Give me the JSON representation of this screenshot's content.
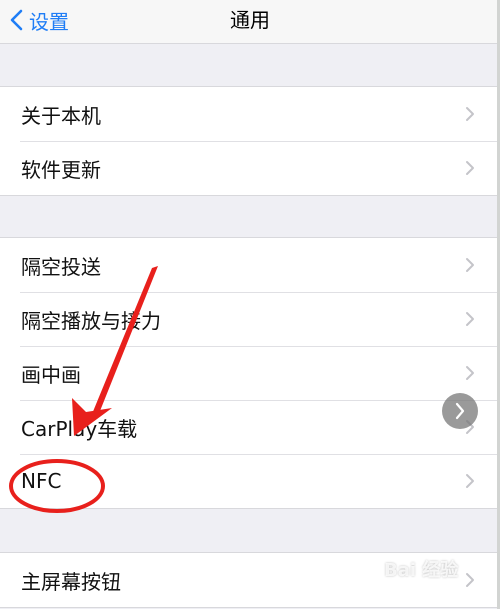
{
  "nav": {
    "back_label": "设置",
    "title": "通用"
  },
  "groups": [
    {
      "items": [
        {
          "label": "关于本机"
        },
        {
          "label": "软件更新"
        }
      ]
    },
    {
      "items": [
        {
          "label": "隔空投送"
        },
        {
          "label": "隔空播放与接力"
        },
        {
          "label": "画中画"
        },
        {
          "label": "CarPlay车载"
        },
        {
          "label": "NFC"
        }
      ]
    },
    {
      "items": [
        {
          "label": "主屏幕按钮"
        }
      ]
    }
  ],
  "watermark": {
    "text": "Bai 经验"
  },
  "colors": {
    "accent": "#1f7df6",
    "background": "#efeff4",
    "annotation": "#e8201c"
  },
  "icons": {
    "back": "chevron-left-icon",
    "row": "chevron-right-icon",
    "float": "chevron-right-icon"
  }
}
